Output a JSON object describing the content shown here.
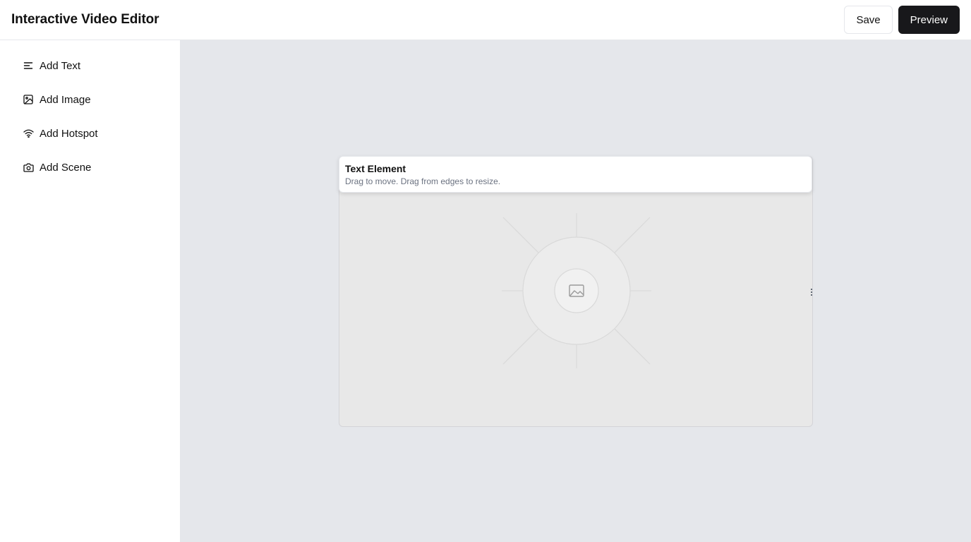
{
  "header": {
    "title": "Interactive Video Editor",
    "save_label": "Save",
    "preview_label": "Preview"
  },
  "sidebar": {
    "items": [
      {
        "label": "Add Text",
        "icon": "text-align-icon"
      },
      {
        "label": "Add Image",
        "icon": "image-icon"
      },
      {
        "label": "Add Hotspot",
        "icon": "wifi-icon"
      },
      {
        "label": "Add Scene",
        "icon": "camera-icon"
      }
    ]
  },
  "canvas": {
    "text_element": {
      "title": "Text Element",
      "hint": "Drag to move. Drag from edges to resize."
    },
    "placeholder_icon": "image-placeholder-icon"
  },
  "colors": {
    "canvas_bg": "#e5e7eb",
    "stage_bg": "#e8e8e8",
    "primary_button": "#18181b",
    "hint_text": "#6b7280"
  }
}
